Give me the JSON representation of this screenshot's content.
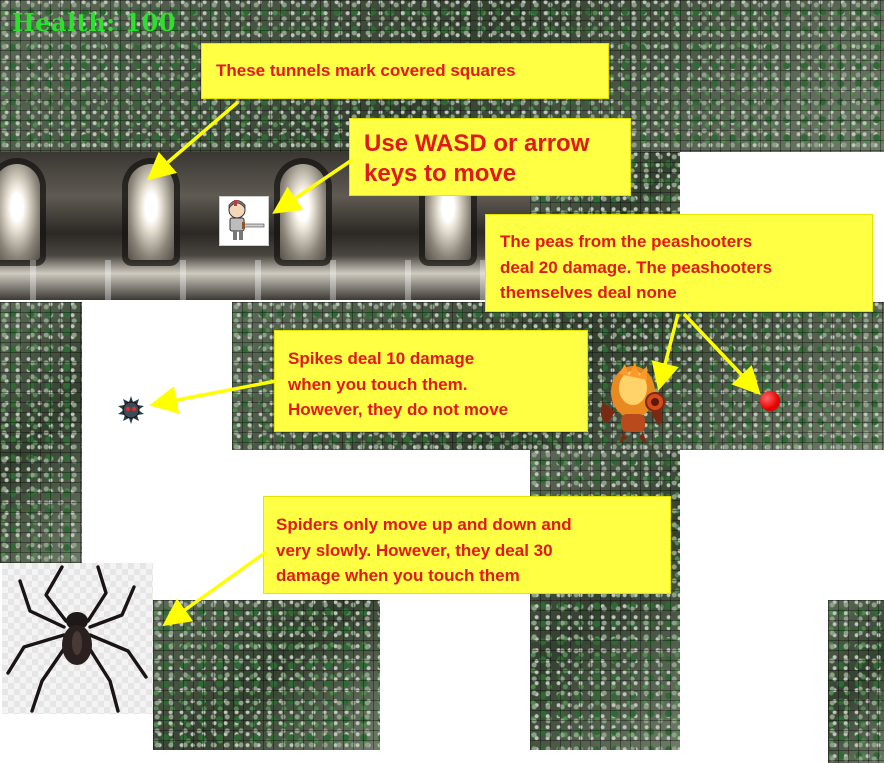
{
  "hud": {
    "health_label": "Health: 100",
    "health_value": 100,
    "color": "#2ee02e"
  },
  "colors": {
    "callout_bg": "#ffff44",
    "callout_text": "#e01a1a",
    "arrow": "#ffff00",
    "wall": "#3c4a3a",
    "floor": "#ffffff",
    "pea": "#e80000"
  },
  "tutorial": {
    "tunnels": {
      "lines": [
        "These tunnels mark covered squares"
      ]
    },
    "move": {
      "lines": [
        "Use WASD or arrow",
        "keys to move"
      ]
    },
    "peas": {
      "lines": [
        "The peas from the peashooters",
        "deal 20 damage. The peashooters",
        "themselves deal none"
      ]
    },
    "spikes": {
      "lines": [
        "Spikes deal 10 damage",
        "when you touch them.",
        "However, they do not move"
      ]
    },
    "spiders": {
      "lines": [
        "Spiders only move up and down and",
        "very slowly. However, they deal 30",
        "damage when you touch them"
      ]
    }
  },
  "entities": {
    "player": {
      "icon": "knight-player-icon"
    },
    "spike": {
      "icon": "spike-ball-icon"
    },
    "peashooter": {
      "icon": "peashooter-icon"
    },
    "pea": {
      "icon": "pea-projectile-icon"
    },
    "spider": {
      "icon": "spider-icon"
    }
  }
}
